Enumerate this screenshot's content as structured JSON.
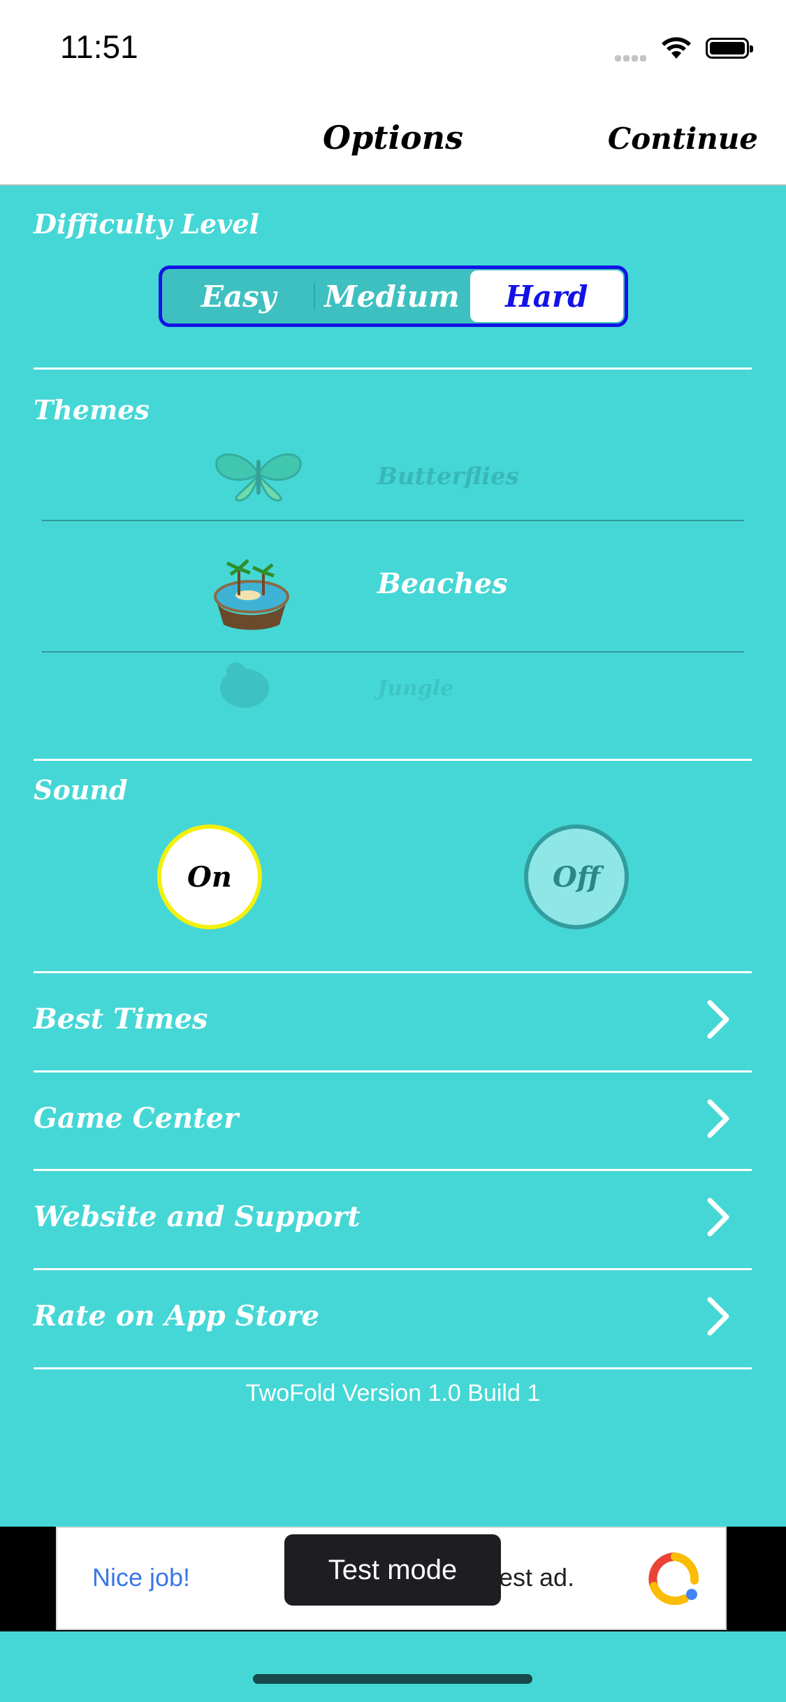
{
  "status": {
    "time": "11:51"
  },
  "nav": {
    "title": "Options",
    "continue_label": "Continue"
  },
  "difficulty": {
    "label": "Difficulty Level",
    "options": [
      "Easy",
      "Medium",
      "Hard"
    ],
    "selected": "Hard"
  },
  "themes": {
    "label": "Themes",
    "items": [
      {
        "name": "Butterflies"
      },
      {
        "name": "Beaches",
        "selected": true
      },
      {
        "name": "Jungle"
      }
    ]
  },
  "sound": {
    "label": "Sound",
    "on_label": "On",
    "off_label": "Off",
    "selected": "On"
  },
  "menu": [
    {
      "label": "Best Times"
    },
    {
      "label": "Game Center"
    },
    {
      "label": "Website and Support"
    },
    {
      "label": "Rate on App Store"
    }
  ],
  "version_text": "TwoFold Version 1.0 Build 1",
  "ad": {
    "left_text": "Nice job!",
    "right_text": "est ad.",
    "toast": "Test mode"
  },
  "colors": {
    "background": "#45d7d6",
    "accent": "#1212e6",
    "sound_on_ring": "#f3f00c"
  }
}
